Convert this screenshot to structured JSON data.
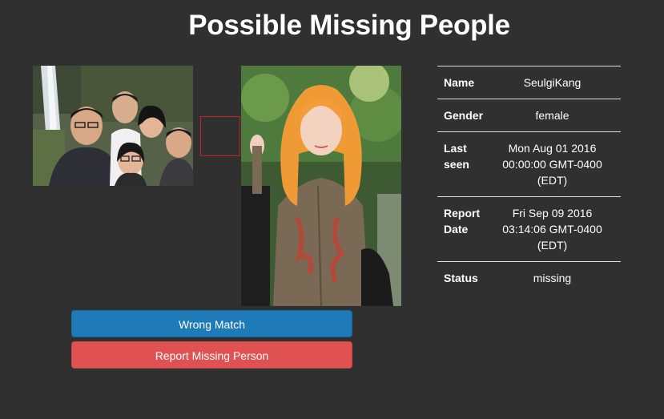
{
  "page": {
    "title": "Possible Missing People"
  },
  "images": {
    "group_photo": "group-selfie-photo",
    "match_photo": "missing-person-photo"
  },
  "details": {
    "rows": [
      {
        "key": "Name",
        "value": "SeulgiKang"
      },
      {
        "key": "Gender",
        "value": "female"
      },
      {
        "key": "Last seen",
        "value": "Mon Aug 01 2016 00:00:00 GMT-0400 (EDT)"
      },
      {
        "key": "Report Date",
        "value": "Fri Sep 09 2016 03:14:06 GMT-0400 (EDT)"
      },
      {
        "key": "Status",
        "value": "missing"
      }
    ]
  },
  "actions": {
    "wrong_match_label": "Wrong Match",
    "report_label": "Report Missing Person"
  },
  "colors": {
    "background": "#303030",
    "primary_button": "#1f7ab8",
    "danger_button": "#e05252",
    "face_box": "#c4202b"
  }
}
